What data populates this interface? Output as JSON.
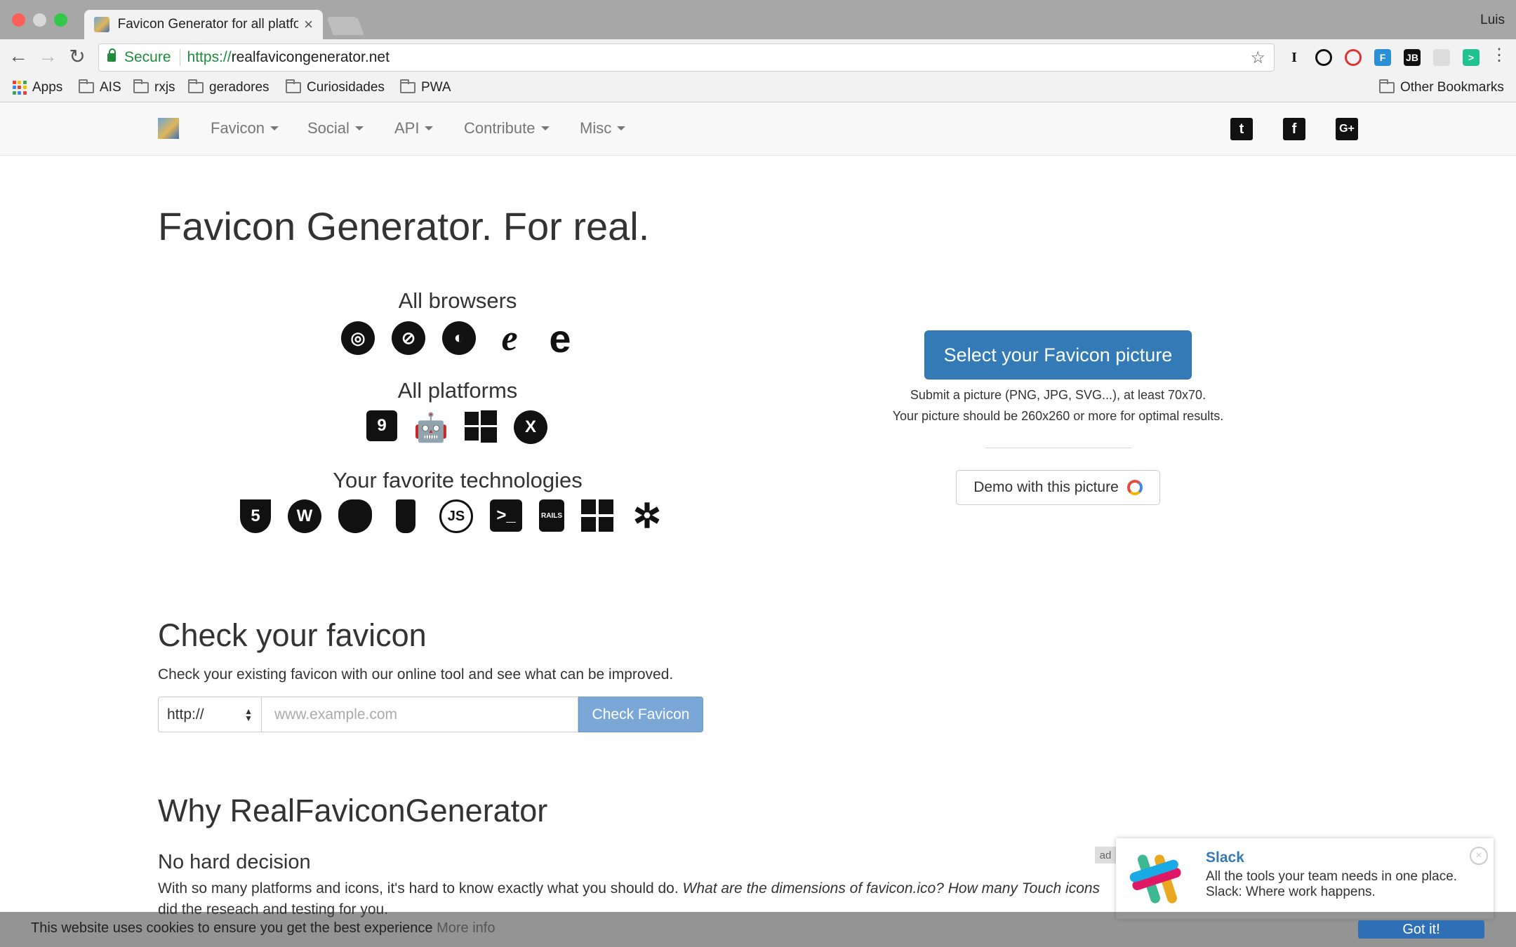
{
  "browser": {
    "tab_title": "Favicon Generator for all platfo",
    "tab_close": "×",
    "profile": "Luis",
    "security_label": "Secure",
    "url_protocol": "https://",
    "url_host": "realfavicongenerator.net",
    "bookmarks": [
      "Apps",
      "AIS",
      "rxjs",
      "geradores",
      "Curiosidades",
      "PWA"
    ],
    "other_bookmarks": "Other Bookmarks"
  },
  "nav": {
    "items": [
      "Favicon",
      "Social",
      "API",
      "Contribute",
      "Misc"
    ]
  },
  "hero": {
    "title": "Favicon Generator. For real.",
    "browsers_heading": "All browsers",
    "platforms_heading": "All platforms",
    "tech_heading": "Your favorite technologies",
    "select_button": "Select your Favicon picture",
    "note_line1": "Submit a picture (PNG, JPG, SVG...), at least 70x70.",
    "note_line2": "Your picture should be 260x260 or more for optimal results.",
    "demo_button": "Demo with this picture"
  },
  "check": {
    "title": "Check your favicon",
    "lead": "Check your existing favicon with our online tool and see what can be improved.",
    "protocol_value": "http://",
    "url_placeholder": "www.example.com",
    "button": "Check Favicon"
  },
  "why": {
    "title": "Why RealFaviconGenerator",
    "subtitle": "No hard decision",
    "para_plain": "With so many platforms and icons, it's hard to know exactly what you should do. ",
    "para_italic": "What are the dimensions of favicon.ico? How many Touch icons",
    "para_line2": "did the reseach and testing for you."
  },
  "ad": {
    "label": "ad",
    "name": "Slack",
    "line1": "All the tools your team needs in one place.",
    "line2": "Slack: Where work happens.",
    "close": "×"
  },
  "cookie": {
    "text": "This website uses cookies to ensure you get the best experience ",
    "more": "More info",
    "button": "Got it!"
  },
  "colors": {
    "primary": "#337ab7",
    "secure_green": "#1e8c3c",
    "check_button": "#7ba7d7"
  }
}
